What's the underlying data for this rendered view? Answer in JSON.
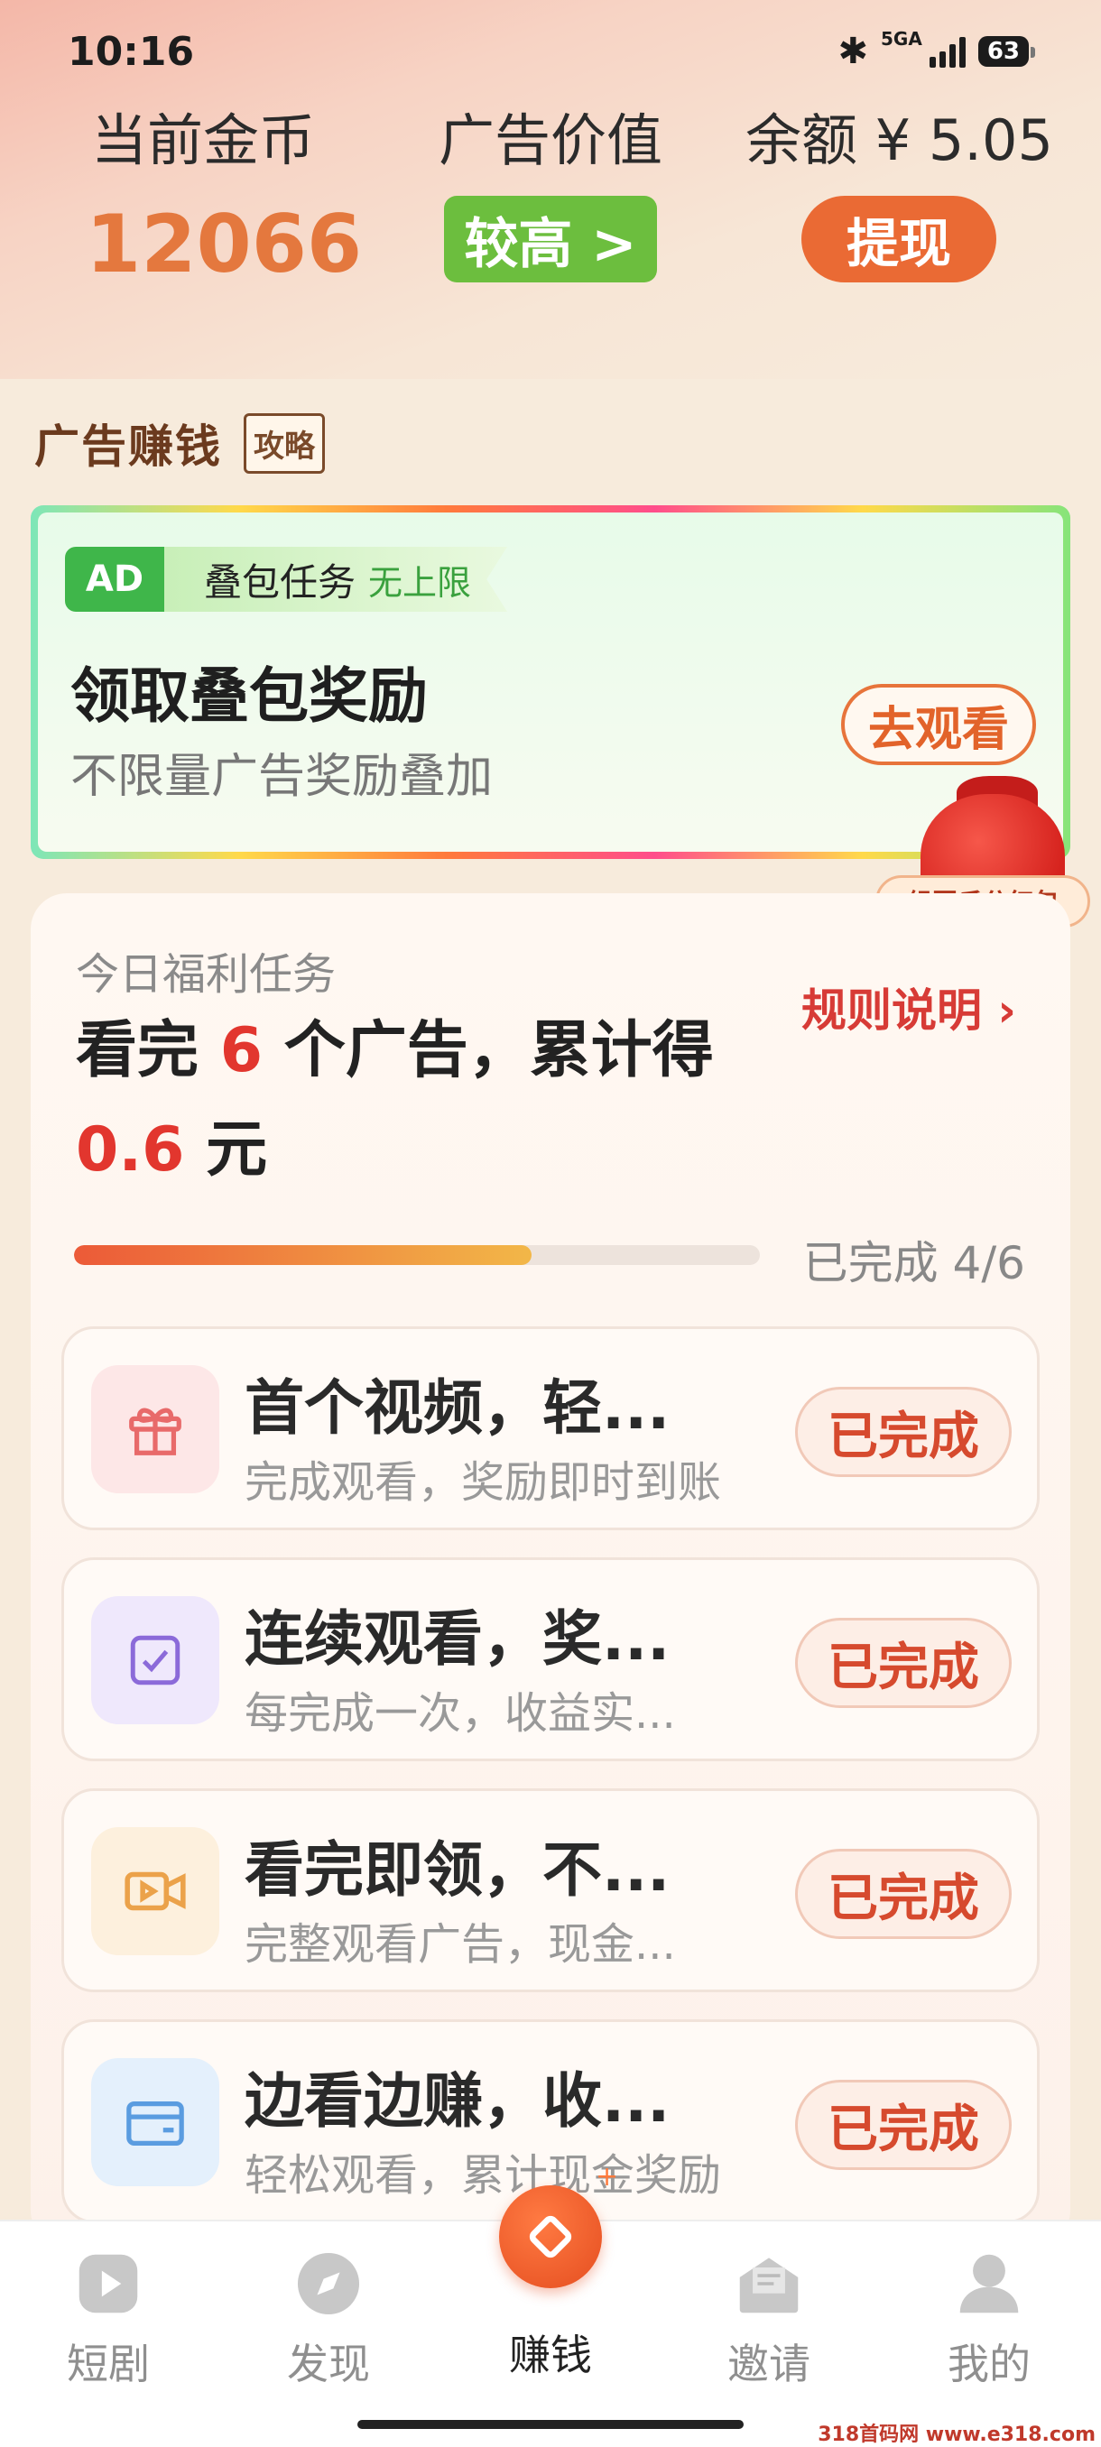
{
  "status": {
    "time": "10:16",
    "network": "5GA",
    "battery": "63"
  },
  "header": {
    "coins_label": "当前金币",
    "coins_value": "12066",
    "ad_value_label": "广告价值",
    "ad_value_button": "较高 >",
    "balance_label": "余额 ¥ 5.05",
    "withdraw_button": "提现"
  },
  "section": {
    "title": "广告赚钱",
    "guide_badge": "攻略"
  },
  "ad_card": {
    "tag": "AD",
    "task_name": "叠包任务",
    "task_sub": "无上限",
    "title": "领取叠包奖励",
    "desc": "不限量广告奖励叠加",
    "button": "去观看"
  },
  "red_bag": {
    "label": "组团瓜分红包"
  },
  "welfare": {
    "subtitle": "今日福利任务",
    "rules": "规则说明 ›",
    "main_pre": "看完 ",
    "main_count": "6",
    "main_mid": " 个广告，累计得 ",
    "main_amount": "0.6",
    "main_post": " 元",
    "progress_label": "已完成 4/6",
    "progress_fraction": 0.667,
    "tasks": [
      {
        "title": "首个视频，轻...",
        "desc": "完成观看，奖励即时到账",
        "button": "已完成",
        "icon": "gift-icon",
        "icon_color": "#e86a6a",
        "icon_bg": "#fde7e7"
      },
      {
        "title": "连续观看，奖...",
        "desc": "每完成一次，收益实...",
        "button": "已完成",
        "icon": "checkbox-icon",
        "icon_color": "#8b6ad9",
        "icon_bg": "#efe8fc"
      },
      {
        "title": "看完即领，不...",
        "desc": "完整观看广告，现金...",
        "button": "已完成",
        "icon": "video-camera-icon",
        "icon_color": "#eba24a",
        "icon_bg": "#fdf0dd"
      },
      {
        "title": "边看边赚，收...",
        "desc": "轻松观看，累计现金奖励",
        "button": "已完成",
        "icon": "wallet-icon",
        "icon_color": "#5a9ce0",
        "icon_bg": "#e4f0fc"
      }
    ]
  },
  "nav": {
    "items": [
      {
        "label": "短剧",
        "icon": "play-icon"
      },
      {
        "label": "发现",
        "icon": "compass-icon"
      },
      {
        "label": "赚钱",
        "icon": "earn-icon"
      },
      {
        "label": "邀请",
        "icon": "invite-icon"
      },
      {
        "label": "我的",
        "icon": "profile-icon"
      }
    ]
  },
  "watermark": "318首码网 www.e318.com",
  "colors": {
    "accent_orange": "#ea6a34",
    "green": "#6cbe3e",
    "red_text": "#e2362e"
  }
}
